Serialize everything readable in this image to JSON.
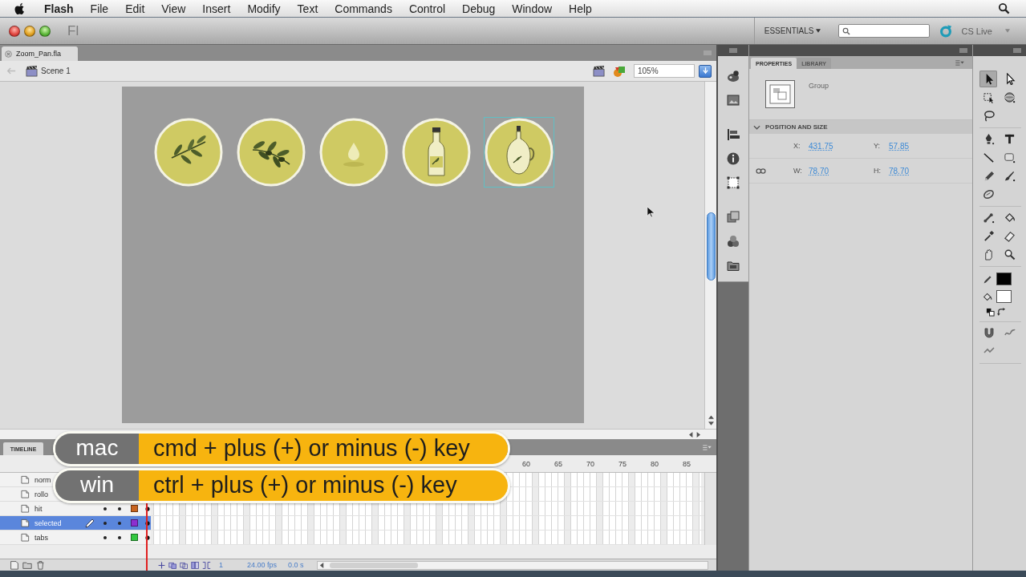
{
  "menu_bar": {
    "app": "Flash",
    "items": [
      "File",
      "Edit",
      "View",
      "Insert",
      "Modify",
      "Text",
      "Commands",
      "Control",
      "Debug",
      "Window",
      "Help"
    ]
  },
  "title_bar": {
    "app_badge": "Fl",
    "workspace": "ESSENTIALS",
    "cs_live": "CS Live"
  },
  "document_tab": {
    "label": "Zoom_Pan.fla"
  },
  "edit_bar": {
    "scene": "Scene 1",
    "zoom": "105%"
  },
  "stage": {
    "symbols": [
      {
        "kind": "sprig",
        "selected": false
      },
      {
        "kind": "branch",
        "selected": false
      },
      {
        "kind": "drop",
        "selected": false
      },
      {
        "kind": "bottle",
        "selected": false
      },
      {
        "kind": "jug",
        "selected": true
      }
    ]
  },
  "shortcut_caption": [
    {
      "platform": "mac",
      "keys": "cmd + plus (+) or minus (-) key"
    },
    {
      "platform": "win",
      "keys": "ctrl + plus (+) or minus (-) key"
    }
  ],
  "timeline": {
    "title": "TIMELINE",
    "frame_numbers": [
      "60",
      "65",
      "70",
      "75",
      "80",
      "85"
    ],
    "layers": [
      {
        "name": "norm",
        "selected": false
      },
      {
        "name": "rollo",
        "selected": false
      },
      {
        "name": "hit",
        "selected": false,
        "color": "#c8641e"
      },
      {
        "name": "selected",
        "selected": true,
        "color": "#8c2ed0"
      },
      {
        "name": "tabs",
        "selected": false,
        "color": "#33c840"
      }
    ],
    "current_frame": "1",
    "frame_rate": "24.00 fps",
    "elapsed": "0.0 s"
  },
  "properties": {
    "tabs": [
      {
        "label": "PROPERTIES",
        "selected": true
      },
      {
        "label": "LIBRARY",
        "selected": false
      }
    ],
    "instance": "Group",
    "section": {
      "title": "POSITION AND SIZE",
      "expanded": true,
      "fields": [
        {
          "label": "X:",
          "value": "431.75"
        },
        {
          "label": "Y:",
          "value": "57.85"
        },
        {
          "label": "W:",
          "value": "78.70"
        },
        {
          "label": "H:",
          "value": "78.70"
        }
      ]
    }
  },
  "tools": {
    "groups": [
      {
        "tools": [
          {
            "kind": "selection",
            "selected": true
          },
          {
            "kind": "subselection",
            "selected": false
          },
          {
            "kind": "free_transform",
            "selected": false
          },
          {
            "kind": "rotate_3d",
            "selected": false
          },
          {
            "kind": "lasso",
            "selected": false
          }
        ]
      },
      {
        "tools": [
          {
            "kind": "pen",
            "selected": false
          },
          {
            "kind": "text",
            "selected": false
          },
          {
            "kind": "line",
            "selected": false
          },
          {
            "kind": "rectangle",
            "selected": false
          },
          {
            "kind": "pencil",
            "selected": false
          },
          {
            "kind": "brush",
            "selected": false
          },
          {
            "kind": "deco",
            "selected": false
          }
        ]
      },
      {
        "tools": [
          {
            "kind": "bone",
            "selected": false
          },
          {
            "kind": "paint_bucket",
            "selected": false
          },
          {
            "kind": "eyedropper",
            "selected": false
          },
          {
            "kind": "eraser",
            "selected": false
          },
          {
            "kind": "hand",
            "selected": false
          },
          {
            "kind": "zoom",
            "selected": false
          }
        ]
      }
    ],
    "colors": [
      {
        "kind": "stroke",
        "color": "#000000"
      },
      {
        "kind": "fill",
        "color": "#ffffff"
      }
    ]
  }
}
